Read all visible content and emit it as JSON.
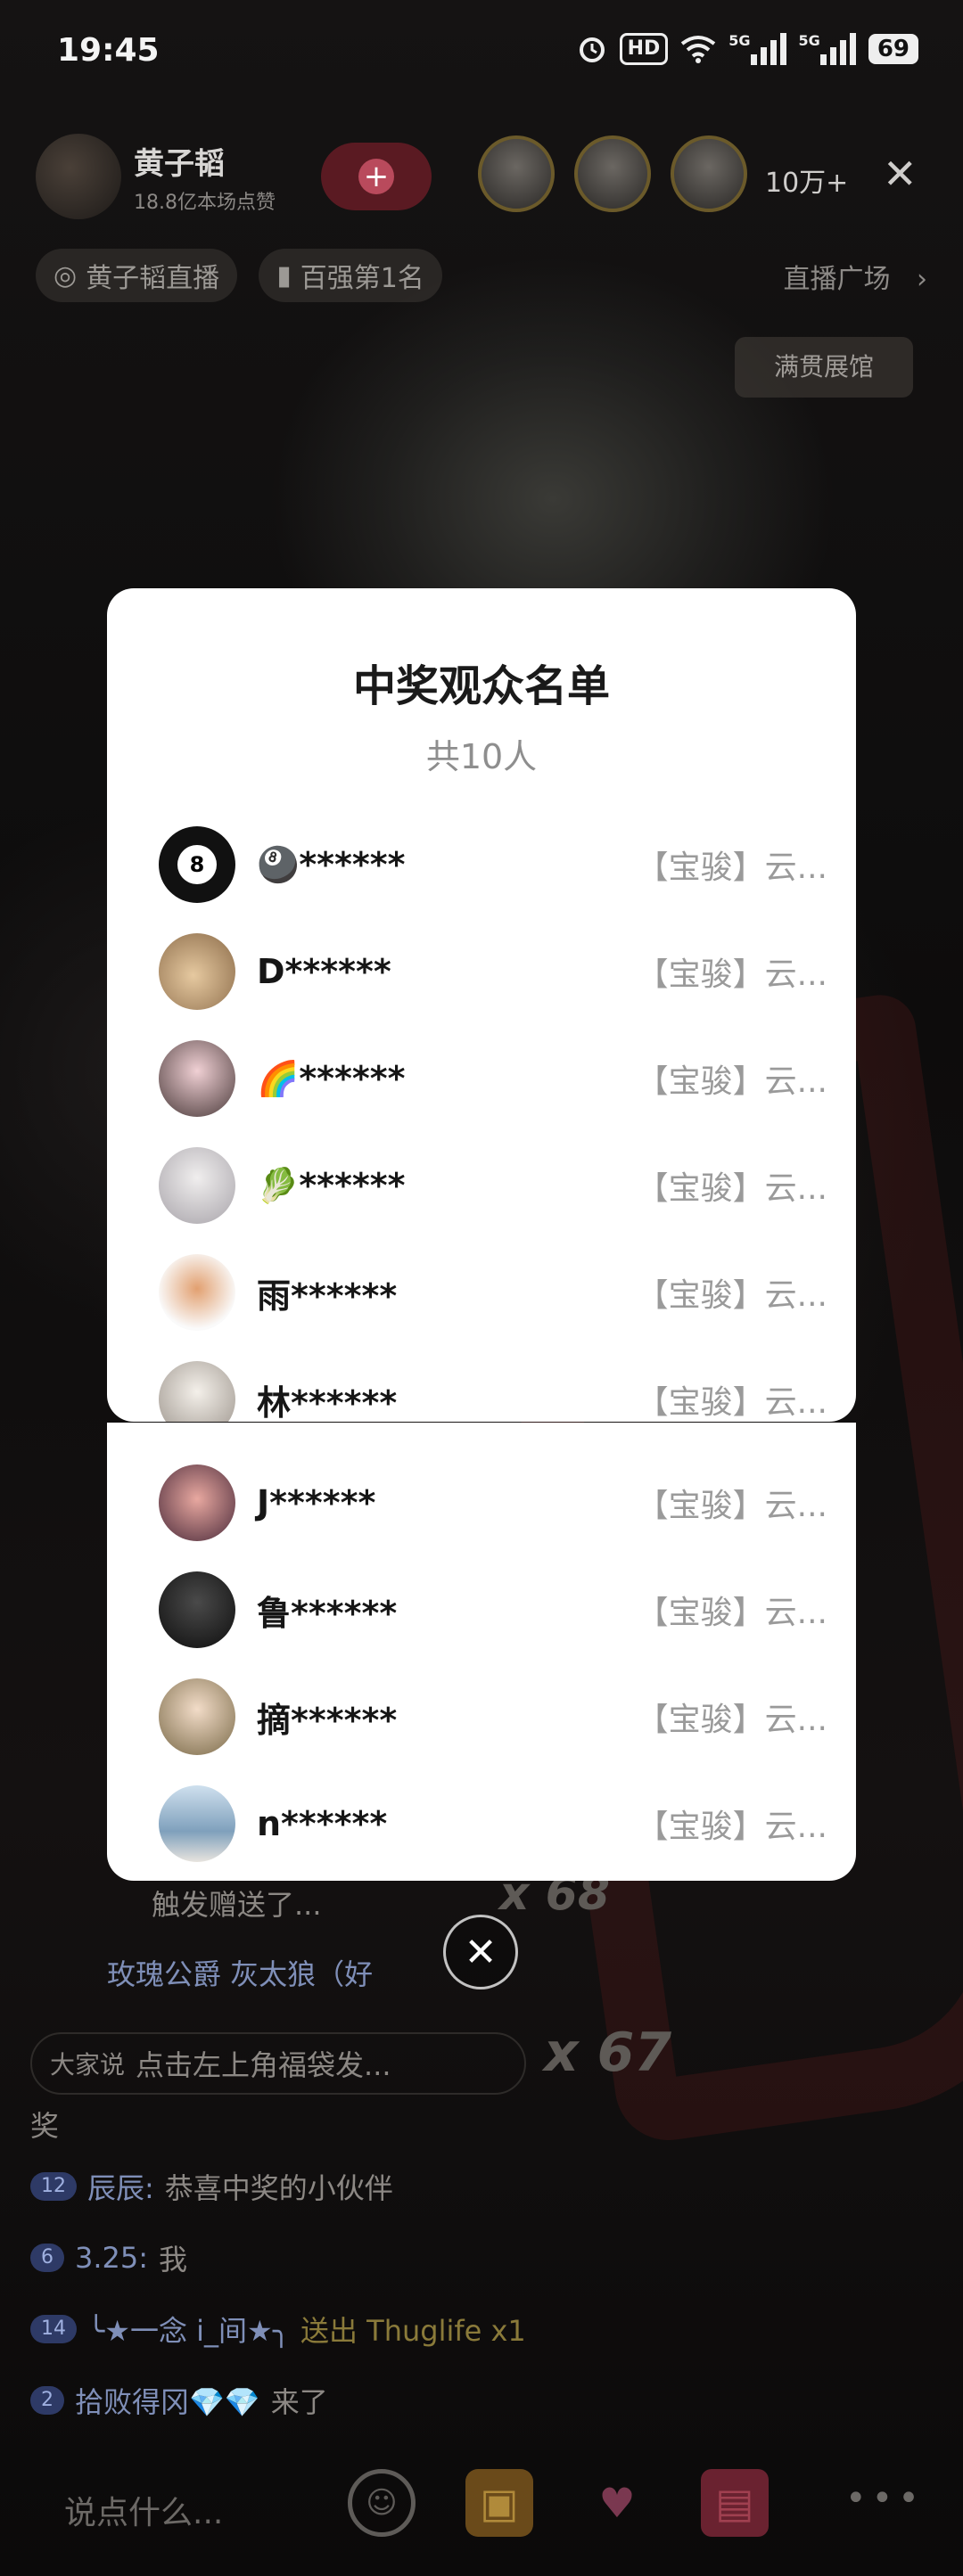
{
  "status_bar": {
    "time": "19:45",
    "hd_label": "HD",
    "net_1": "5G",
    "net_2": "5G",
    "battery": "69"
  },
  "live": {
    "host_name": "黄子韬",
    "host_sub": "18.8亿本场点赞",
    "viewer_count": "10万+",
    "tags": [
      "黄子韬直播",
      "百强第1名"
    ],
    "plaza": "直播广场",
    "exhibit": "满贯展馆"
  },
  "chat": {
    "trigger_text": "触发赠送了...",
    "combo_1": "x 68",
    "rose_line": "玫瑰公爵  灰太狼（好",
    "everyone_says_label": "大家说",
    "everyone_says_text": "点击左上角福袋发...",
    "combo_2": "x 67",
    "prize_word": "奖",
    "rows": [
      {
        "level": "12",
        "name": "辰辰:",
        "msg": "恭喜中奖的小伙伴"
      },
      {
        "level": "6",
        "name": "3.25:",
        "msg": "我"
      },
      {
        "level": "14",
        "name": "╰★一念 i_间★╮",
        "msg": "送出 Thuglife x1"
      },
      {
        "level": "2",
        "name": "拾败得冈💎💎",
        "msg": "来了"
      }
    ]
  },
  "bottom": {
    "input_placeholder": "说点什么..."
  },
  "modal": {
    "title": "中奖观众名单",
    "subtitle": "共10人",
    "winners": [
      {
        "name": "🎱******",
        "prize": "【宝骏】云...",
        "avatar_bg": "#111111"
      },
      {
        "name": "D******",
        "prize": "【宝骏】云...",
        "avatar_bg": "#c9a27a"
      },
      {
        "name": "🌈******",
        "prize": "【宝骏】云...",
        "avatar_bg": "#5a4a48"
      },
      {
        "name": "🥬******",
        "prize": "【宝骏】云...",
        "avatar_bg": "#c8c6cc"
      },
      {
        "name": "雨******",
        "prize": "【宝骏】云...",
        "avatar_bg": "#f2f0ee"
      },
      {
        "name": "林******",
        "prize": "【宝骏】云...",
        "avatar_bg": "#d9d4cc"
      },
      {
        "name": "J******",
        "prize": "【宝骏】云...",
        "avatar_bg": "#7a3a3c"
      },
      {
        "name": "鲁******",
        "prize": "【宝骏】云...",
        "avatar_bg": "#1e1e1e"
      },
      {
        "name": "摘******",
        "prize": "【宝骏】云...",
        "avatar_bg": "#9a8a6a"
      },
      {
        "name": "n******",
        "prize": "【宝骏】云...",
        "avatar_bg": "#9fb8d0"
      }
    ]
  }
}
